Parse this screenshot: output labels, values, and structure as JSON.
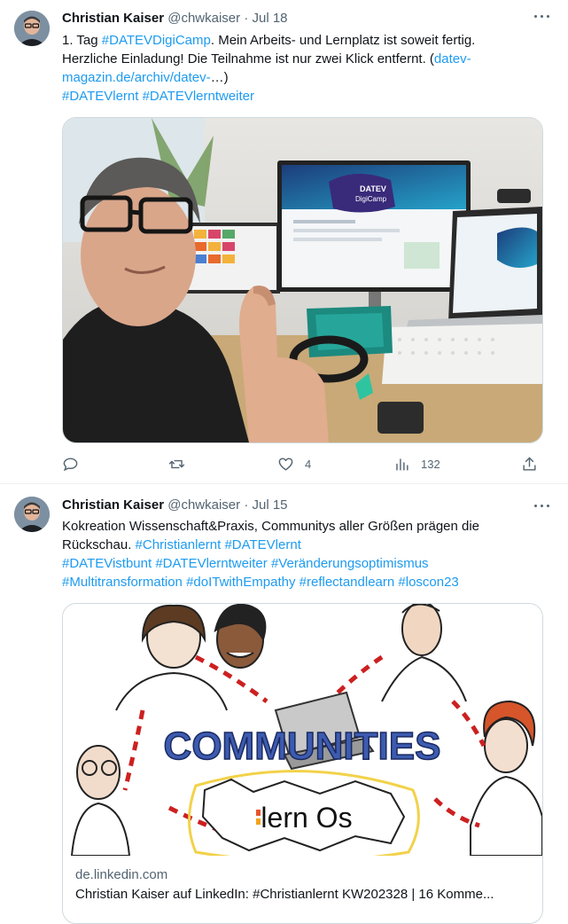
{
  "tweets": [
    {
      "author": {
        "name": "Christian Kaiser",
        "handle": "@chwkaiser"
      },
      "separator": "·",
      "date": "Jul 18",
      "lines": [
        [
          {
            "t": "1. Tag ",
            "link": false
          },
          {
            "t": "#DATEVDigiCamp",
            "link": true
          },
          {
            "t": ". Mein Arbeits- und Lernplatz ist soweit fertig.",
            "link": false
          }
        ],
        [
          {
            "t": "Herzliche Einladung! Die Teilnahme ist nur zwei Klick entfernt. (",
            "link": false
          },
          {
            "t": "datev-",
            "link": true
          }
        ],
        [
          {
            "t": "magazin.de/archiv/datev-",
            "link": true
          },
          {
            "t": "…)",
            "link": false
          }
        ],
        [
          {
            "t": "#DATEVlernt",
            "link": true
          },
          {
            "t": " ",
            "link": false
          },
          {
            "t": "#DATEVlerntweiter",
            "link": true
          }
        ]
      ],
      "photo": {
        "screen_brand": "DATEV",
        "screen_title": "DigiCamp"
      },
      "actions": {
        "reply": "",
        "retweet": "",
        "like": "4",
        "views": "132"
      }
    },
    {
      "author": {
        "name": "Christian Kaiser",
        "handle": "@chwkaiser"
      },
      "separator": "·",
      "date": "Jul 15",
      "lines": [
        [
          {
            "t": "Kokreation Wissenschaft&Praxis, Communitys aller Größen prägen die",
            "link": false
          }
        ],
        [
          {
            "t": "Rückschau. ",
            "link": false
          },
          {
            "t": "#Christianlernt",
            "link": true
          },
          {
            "t": " ",
            "link": false
          },
          {
            "t": "#DATEVlernt",
            "link": true
          }
        ],
        [
          {
            "t": "#DATEVistbunt",
            "link": true
          },
          {
            "t": " ",
            "link": false
          },
          {
            "t": "#DATEVlerntweiter",
            "link": true
          },
          {
            "t": " ",
            "link": false
          },
          {
            "t": "#Veränderungsoptimismus",
            "link": true
          }
        ],
        [
          {
            "t": "#Multitransformation",
            "link": true
          },
          {
            "t": "  ",
            "link": false
          },
          {
            "t": "#doITwithEmpathy",
            "link": true
          },
          {
            "t": " ",
            "link": false
          },
          {
            "t": "#reflectandlearn",
            "link": true
          },
          {
            "t": " ",
            "link": false
          },
          {
            "t": "#loscon23",
            "link": true
          }
        ]
      ],
      "card": {
        "image_text_1": "COMMUNITIES",
        "image_text_2": "lern Os",
        "domain": "de.linkedin.com",
        "title": "Christian Kaiser auf LinkedIn: #Christianlernt KW202328 | 16 Komme..."
      }
    }
  ],
  "colors": {
    "link": "#1d9bf0",
    "muted": "#536471",
    "border": "#cfd9de"
  },
  "icons": [
    "more-icon",
    "reply-icon",
    "retweet-icon",
    "like-icon",
    "views-icon",
    "share-icon"
  ]
}
